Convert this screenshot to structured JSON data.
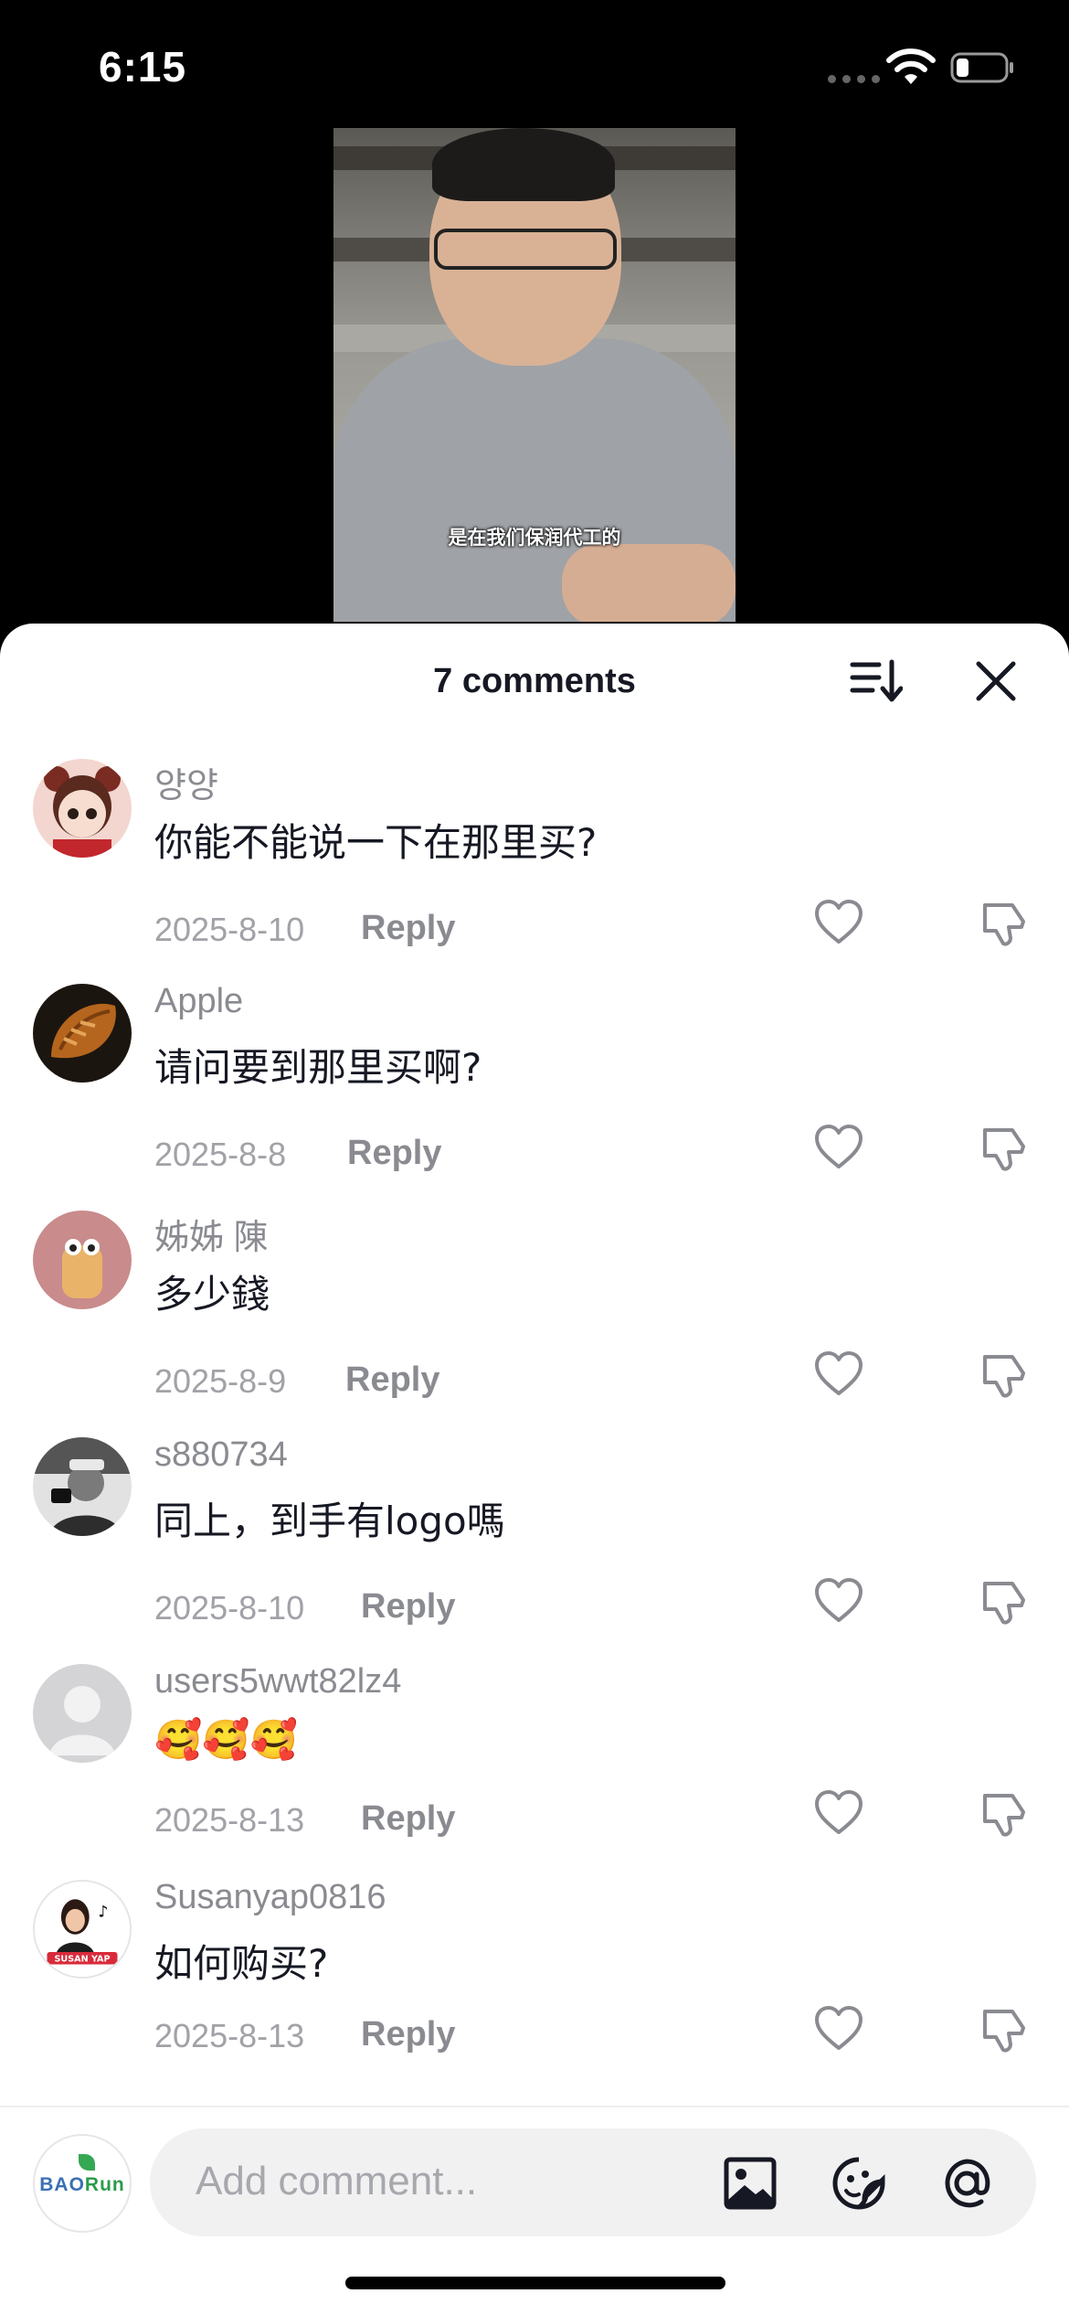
{
  "status_bar": {
    "time": "6:15",
    "wifi_icon": "wifi-icon",
    "battery_icon": "battery-icon",
    "battery_level": 0.25
  },
  "video": {
    "caption": "是在我们保润代工的"
  },
  "comments_panel": {
    "title": "7 comments",
    "sort_icon": "sort-icon",
    "close_icon": "close-icon"
  },
  "comments": [
    {
      "username": "양양",
      "text": "你能不能说一下在那里买?",
      "date": "2025-8-10",
      "reply": "Reply",
      "avatar_color": "#f2d6cf"
    },
    {
      "username": "Apple",
      "text": "请问要到那里买啊?",
      "date": "2025-8-8",
      "reply": "Reply",
      "avatar_color": "#7b4a22"
    },
    {
      "username": "姊姊 陳",
      "text": "多少錢",
      "date": "2025-8-9",
      "reply": "Reply",
      "avatar_color": "#c98b8b"
    },
    {
      "username": "s880734",
      "text": "同上，到手有logo嗎",
      "date": "2025-8-10",
      "reply": "Reply",
      "avatar_color": "#9c9c9c"
    },
    {
      "username": "users5wwt82lz4",
      "text": "🥰🥰🥰",
      "date": "2025-8-13",
      "reply": "Reply",
      "avatar_color": "#d4d4d6"
    },
    {
      "username": "Susanyap0816",
      "text": "如何购买?",
      "date": "2025-8-13",
      "reply": "Reply",
      "avatar_color": "#ffffff"
    }
  ],
  "composer": {
    "placeholder": "Add comment...",
    "avatar_logo": {
      "prefix": "BAO",
      "suffix": "Run"
    },
    "image_icon": "image-icon",
    "emoji_icon": "emoji-icon",
    "mention_icon": "mention-icon"
  },
  "colors": {
    "accent_text": "#161823",
    "secondary_text": "#8a8b91",
    "sheet_bg": "#ffffff"
  }
}
